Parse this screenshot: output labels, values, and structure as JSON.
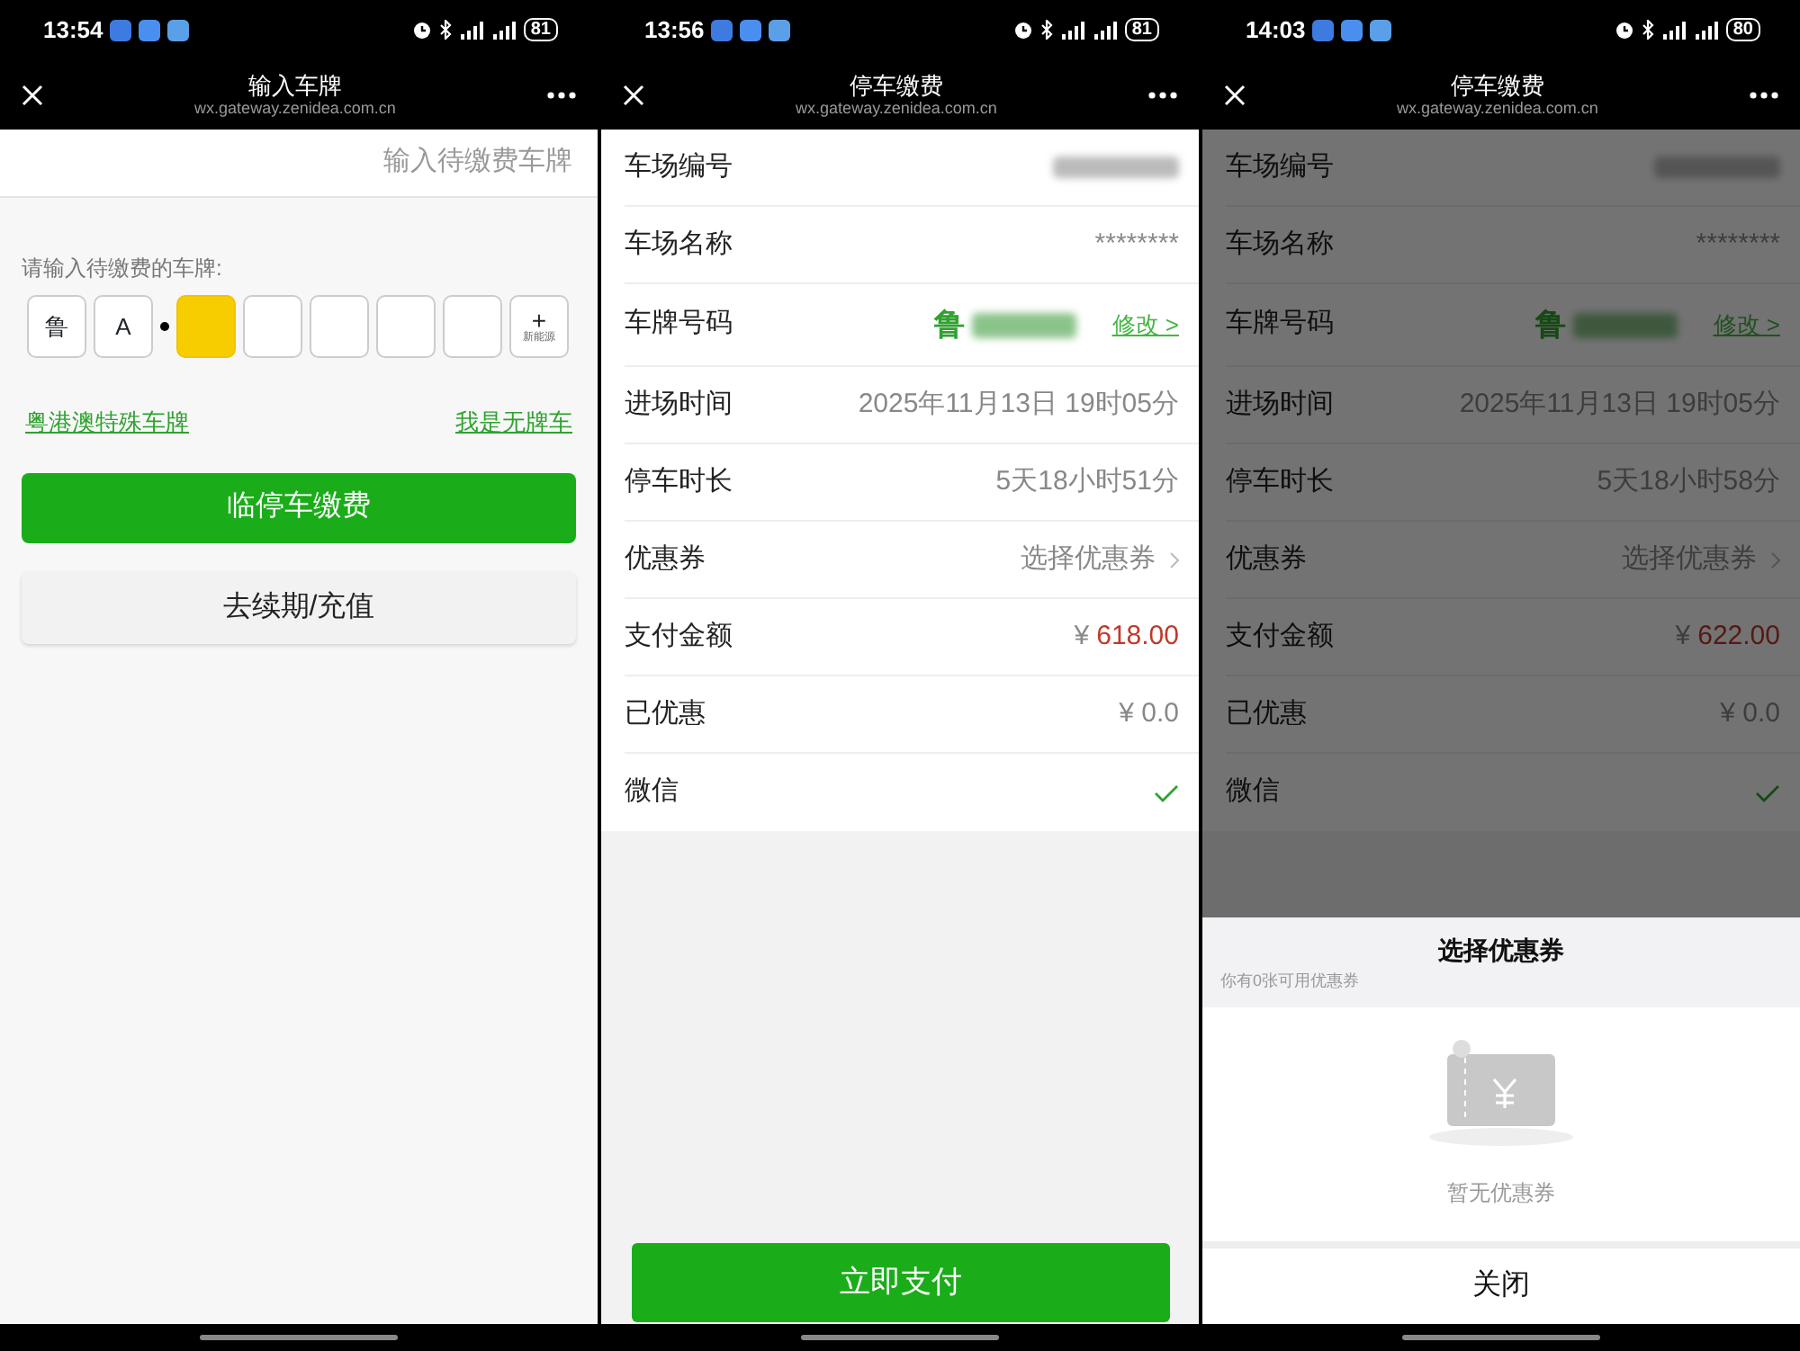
{
  "screens": [
    {
      "kind": "plate_entry",
      "status": {
        "time": "13:54",
        "battery": "81"
      },
      "header": {
        "title": "输入车牌",
        "url": "wx.gateway.zenidea.com.cn"
      },
      "section_title": "输入待缴费车牌",
      "prompt": "请输入待缴费的车牌:",
      "plate_cells": [
        {
          "kind": "char",
          "text": "鲁",
          "selected": false
        },
        {
          "kind": "char",
          "text": "A",
          "selected": false
        },
        {
          "kind": "empty",
          "selected": true
        },
        {
          "kind": "empty",
          "selected": false
        },
        {
          "kind": "empty",
          "selected": false
        },
        {
          "kind": "empty",
          "selected": false
        },
        {
          "kind": "empty",
          "selected": false
        },
        {
          "kind": "new_energy",
          "symbol": "+",
          "text": "新能源",
          "selected": false
        }
      ],
      "links": [
        "粤港澳特殊车牌",
        "我是无牌车"
      ],
      "buttons": [
        {
          "kind": "primary",
          "label": "临停车缴费"
        },
        {
          "kind": "secondary",
          "label": "去续期/充值"
        }
      ]
    },
    {
      "kind": "payment",
      "dimmed": false,
      "status": {
        "time": "13:56",
        "battery": "81"
      },
      "header": {
        "title": "停车缴费",
        "url": "wx.gateway.zenidea.com.cn"
      },
      "rows": [
        {
          "kind": "blurred",
          "label": "车场编号"
        },
        {
          "kind": "text",
          "label": "车场名称",
          "value": "********"
        },
        {
          "kind": "plate",
          "label": "车牌号码",
          "prefix": "鲁",
          "action": "修改 >"
        },
        {
          "kind": "text",
          "label": "进场时间",
          "value": "2025年11月13日 19时05分"
        },
        {
          "kind": "text",
          "label": "停车时长",
          "value": "5天18小时51分"
        },
        {
          "kind": "link",
          "label": "优惠券",
          "value": "选择优惠券"
        },
        {
          "kind": "amount",
          "label": "支付金额",
          "currency": "¥",
          "value": "618.00"
        },
        {
          "kind": "text",
          "label": "已优惠",
          "value": "¥ 0.0"
        },
        {
          "kind": "check",
          "label": "微信",
          "checked": true
        }
      ],
      "pay_button": "立即支付"
    },
    {
      "kind": "payment",
      "dimmed": true,
      "status": {
        "time": "14:03",
        "battery": "80"
      },
      "header": {
        "title": "停车缴费",
        "url": "wx.gateway.zenidea.com.cn"
      },
      "rows": [
        {
          "kind": "blurred",
          "label": "车场编号"
        },
        {
          "kind": "text",
          "label": "车场名称",
          "value": "********"
        },
        {
          "kind": "plate",
          "label": "车牌号码",
          "prefix": "鲁",
          "action": "修改 >"
        },
        {
          "kind": "text",
          "label": "进场时间",
          "value": "2025年11月13日 19时05分"
        },
        {
          "kind": "text",
          "label": "停车时长",
          "value": "5天18小时58分"
        },
        {
          "kind": "link",
          "label": "优惠券",
          "value": "选择优惠券"
        },
        {
          "kind": "amount",
          "label": "支付金额",
          "currency": "¥",
          "value": "622.00"
        },
        {
          "kind": "text",
          "label": "已优惠",
          "value": "¥ 0.0"
        },
        {
          "kind": "check",
          "label": "微信",
          "checked": true
        }
      ],
      "sheet": {
        "title": "选择优惠券",
        "subtitle": "你有0张可用优惠券",
        "empty_text": "暂无优惠券",
        "close": "关闭"
      }
    }
  ]
}
